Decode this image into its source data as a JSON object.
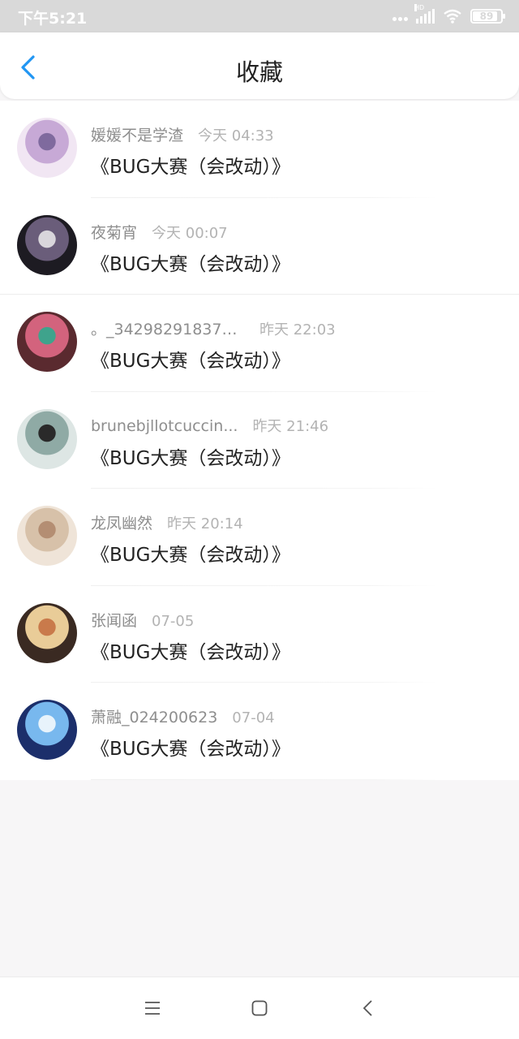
{
  "status_bar": {
    "time": "下午5:21",
    "network": "HD",
    "battery": "89"
  },
  "header": {
    "title": "收藏"
  },
  "items": [
    {
      "name": "媛媛不是学渣",
      "time": "今天 04:33",
      "content": "《BUG大赛（会改动）》",
      "avatar_colors": [
        "#f1e6f3",
        "#c7a9d6",
        "#7f6a9e"
      ]
    },
    {
      "name": "夜菊宵",
      "time": "今天 00:07",
      "content": "《BUG大赛（会改动）》",
      "avatar_colors": [
        "#1d1b22",
        "#6a5d7a",
        "#d9d6db"
      ]
    },
    {
      "name": "。_342982918374...",
      "time": "昨天 22:03",
      "content": "《BUG大赛（会改动）》",
      "avatar_colors": [
        "#5a2a2f",
        "#d3637d",
        "#3fa38c"
      ]
    },
    {
      "name": "brunebjllotcuccin...",
      "time": "昨天 21:46",
      "content": "《BUG大赛（会改动）》",
      "avatar_colors": [
        "#dde6e4",
        "#8faaa5",
        "#2a2a2a"
      ]
    },
    {
      "name": "龙凤幽然",
      "time": "昨天 20:14",
      "content": "《BUG大赛（会改动）》",
      "avatar_colors": [
        "#efe4d8",
        "#d7c1a9",
        "#b48e73"
      ]
    },
    {
      "name": "张闻函",
      "time": "07-05",
      "content": "《BUG大赛（会改动）》",
      "avatar_colors": [
        "#3a2a22",
        "#e9cc98",
        "#c97a4b"
      ]
    },
    {
      "name": "萧融_024200623",
      "time": "07-04",
      "content": "《BUG大赛（会改动）》",
      "avatar_colors": [
        "#1c2f6b",
        "#78b8ee",
        "#e8f3fb"
      ]
    }
  ],
  "nav": {
    "menu_icon": "menu-icon",
    "home_icon": "home-icon",
    "back_icon": "back-icon"
  },
  "colors": {
    "accent": "#2196f3",
    "status_bar": "#d9d9d9"
  }
}
